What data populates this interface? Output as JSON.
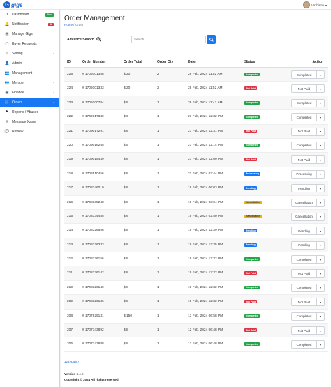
{
  "brand": {
    "logo_letter": "G",
    "logo_text": "gigs"
  },
  "user": {
    "name": "VK bishu"
  },
  "sidebar": {
    "items": [
      {
        "label": "Dashboard",
        "icon": "speedometer-icon",
        "glyph": "◔",
        "badge": "Start",
        "badge_color": "green"
      },
      {
        "label": "Notification",
        "icon": "bell-icon",
        "glyph": "🔔",
        "badge": "56",
        "badge_color": "red"
      },
      {
        "label": "Manage Gigs",
        "icon": "file-icon",
        "glyph": "▤"
      },
      {
        "label": "Buyer Requests",
        "icon": "document-icon",
        "glyph": "▢"
      },
      {
        "label": "Setting",
        "icon": "gear-icon",
        "glyph": "⚙",
        "chevron": "‹"
      },
      {
        "label": "Admin",
        "icon": "person-icon",
        "glyph": "👤",
        "chevron": "‹"
      },
      {
        "label": "Management",
        "icon": "people-icon",
        "glyph": "👥",
        "chevron": "‹"
      },
      {
        "label": "Member",
        "icon": "group-icon",
        "glyph": "👥",
        "chevron": "‹"
      },
      {
        "label": "Finance",
        "icon": "finance-icon",
        "glyph": "▦",
        "chevron": "‹"
      },
      {
        "label": "Orders",
        "icon": "cart-icon",
        "glyph": "🛒",
        "chevron": "‹",
        "active": true
      },
      {
        "label": "Reports / Abuses",
        "icon": "flag-icon",
        "glyph": "⚑",
        "chevron": "‹"
      },
      {
        "label": "Message Xzom",
        "icon": "message-icon",
        "glyph": "✉"
      },
      {
        "label": "Review",
        "icon": "chat-icon",
        "glyph": "💬"
      }
    ]
  },
  "page": {
    "title": "Order Management",
    "crumb_home": "Home",
    "crumb_sep": "/",
    "crumb_current": "Order"
  },
  "search": {
    "advance_label": "Advance Search",
    "placeholder": "Search..."
  },
  "table": {
    "headers": {
      "id": "ID",
      "order_number": "Order Number",
      "order_total": "Order Total",
      "order_qty": "Order Qty",
      "date": "Date",
      "status": "Status",
      "action": "Action"
    },
    "rows": [
      {
        "id": "225",
        "num": "# 1709101358",
        "total": "$ 20",
        "qty": "2",
        "date": "28 Feb, 2024 11:52 AM",
        "status": "Completed",
        "sclass": "completed",
        "action": "Completed"
      },
      {
        "id": "224",
        "num": "# 1709101333",
        "total": "$ 20",
        "qty": "2",
        "date": "28 Feb, 2024 11:52 AM",
        "status": "Not Paid",
        "sclass": "notpaid",
        "action": "Not Paid"
      },
      {
        "id": "223",
        "num": "# 1709100784",
        "total": "$ 8",
        "qty": "1",
        "date": "28 Feb, 2024 11:43 AM",
        "status": "Completed",
        "sclass": "completed",
        "action": "Completed"
      },
      {
        "id": "222",
        "num": "# 1709017330",
        "total": "$ 6",
        "qty": "1",
        "date": "27 Feb, 2024 12:32 PM",
        "status": "Completed",
        "sclass": "completed",
        "action": "Completed"
      },
      {
        "id": "221",
        "num": "# 1709017291",
        "total": "$ 6",
        "qty": "1",
        "date": "27 Feb, 2024 12:31 PM",
        "status": "Not Paid",
        "sclass": "notpaid",
        "action": "Not Paid"
      },
      {
        "id": "220",
        "num": "# 1709016255",
        "total": "$ 5",
        "qty": "1",
        "date": "27 Feb, 2024 12:14 PM",
        "status": "Completed",
        "sclass": "completed",
        "action": "Completed"
      },
      {
        "id": "219",
        "num": "# 1709015439",
        "total": "$ 6",
        "qty": "1",
        "date": "27 Feb, 2024 12:00 PM",
        "status": "Not Paid",
        "sclass": "notpaid",
        "action": "Not Paid"
      },
      {
        "id": "218",
        "num": "# 1708510456",
        "total": "$ 8",
        "qty": "1",
        "date": "21 Feb, 2024 03:44 PM",
        "status": "Processing",
        "sclass": "processing",
        "action": "Processing"
      },
      {
        "id": "217",
        "num": "# 1708346019",
        "total": "$ 6",
        "qty": "1",
        "date": "19 Feb, 2024 06:03 PM",
        "status": "Pending",
        "sclass": "pending",
        "action": "Pending"
      },
      {
        "id": "216",
        "num": "# 1708335248",
        "total": "$ 8",
        "qty": "1",
        "date": "19 Feb, 2024 03:04 PM",
        "status": "Cancellation",
        "sclass": "cancellation",
        "action": "Cancellation"
      },
      {
        "id": "215",
        "num": "# 1708334455",
        "total": "$ 6",
        "qty": "1",
        "date": "19 Feb, 2024 02:50 PM",
        "status": "Cancellation",
        "sclass": "cancellation",
        "action": "Cancellation"
      },
      {
        "id": "214",
        "num": "# 1708326556",
        "total": "$ 8",
        "qty": "1",
        "date": "19 Feb, 2024 12:39 PM",
        "status": "Pending",
        "sclass": "pending",
        "action": "Pending"
      },
      {
        "id": "213",
        "num": "# 1708326333",
        "total": "$ 8",
        "qty": "1",
        "date": "19 Feb, 2024 12:35 PM",
        "status": "Pending",
        "sclass": "pending",
        "action": "Pending"
      },
      {
        "id": "212",
        "num": "# 1708326156",
        "total": "$ 8",
        "qty": "1",
        "date": "19 Feb, 2024 12:32 PM",
        "status": "Completed",
        "sclass": "completed",
        "action": "Completed"
      },
      {
        "id": "211",
        "num": "# 1708326142",
        "total": "$ 8",
        "qty": "1",
        "date": "19 Feb, 2024 12:32 PM",
        "status": "Not Paid",
        "sclass": "notpaid",
        "action": "Not Paid"
      },
      {
        "id": "210",
        "num": "# 1708326140",
        "total": "$ 8",
        "qty": "1",
        "date": "19 Feb, 2024 12:32 PM",
        "status": "Completed",
        "sclass": "completed",
        "action": "Completed"
      },
      {
        "id": "209",
        "num": "# 1708326136",
        "total": "$ 8",
        "qty": "1",
        "date": "19 Feb, 2024 12:32 PM",
        "status": "Not Paid",
        "sclass": "notpaid",
        "action": "Not Paid"
      },
      {
        "id": "208",
        "num": "# 1707829131",
        "total": "$ 150",
        "qty": "1",
        "date": "13 Feb, 2024 06:58 PM",
        "status": "Completed",
        "sclass": "completed",
        "action": "Completed"
      },
      {
        "id": "207",
        "num": "# 1707743892",
        "total": "$ 8",
        "qty": "1",
        "date": "12 Feb, 2024 06:48 PM",
        "status": "Not Paid",
        "sclass": "notpaid",
        "action": "Not Paid"
      },
      {
        "id": "206",
        "num": "# 1707743888",
        "total": "$ 8",
        "qty": "1",
        "date": "12 Feb, 2024 06:48 PM",
        "status": "Completed",
        "sclass": "completed",
        "action": "Completed"
      }
    ]
  },
  "pagination": {
    "text": "123»Last ›"
  },
  "footer": {
    "version_label": "Version",
    "version": "2.4.0",
    "copyright": "Copyright © 2024 All rights reserved."
  },
  "colors": {
    "accent": "#1877f2",
    "completed": "#22a447",
    "not_paid": "#dc3545",
    "cancellation": "#f0b400"
  }
}
